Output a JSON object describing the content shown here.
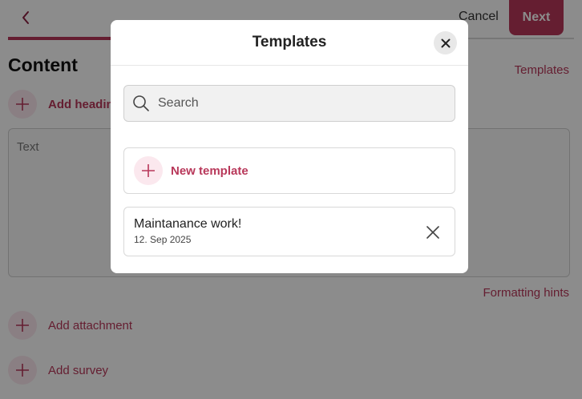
{
  "header": {
    "cancel_label": "Cancel",
    "next_label": "Next"
  },
  "content": {
    "title": "Content",
    "templates_link": "Templates",
    "add_heading": "Add heading",
    "text_placeholder": "Text",
    "formatting_hints": "Formatting hints",
    "add_attachment": "Add attachment",
    "add_survey": "Add survey"
  },
  "modal": {
    "title": "Templates",
    "search_placeholder": "Search",
    "new_template_label": "New template",
    "templates": [
      {
        "name": "Maintanance work!",
        "date": "12. Sep 2025"
      }
    ]
  },
  "colors": {
    "accent": "#b8385a",
    "accent_light": "#fbe8ee"
  },
  "icons": {
    "back": "chevron-left-icon",
    "close": "close-icon",
    "search": "search-icon",
    "plus": "plus-icon",
    "remove": "close-icon"
  }
}
